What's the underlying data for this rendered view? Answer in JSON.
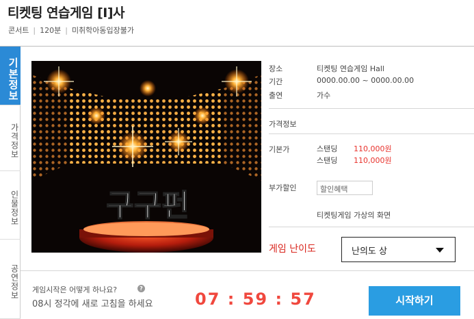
{
  "header": {
    "title": "티켓팅 연습게임 [I]사",
    "meta": [
      "콘서트",
      "120분",
      "미취학아동입장불가"
    ]
  },
  "tabs": [
    {
      "label": "기본정보",
      "active": true
    },
    {
      "label": "가격정보",
      "active": false
    },
    {
      "label": "인물정보",
      "active": false
    },
    {
      "label": "공연정보",
      "active": false
    }
  ],
  "poster": {
    "text": "구구펀"
  },
  "info": {
    "venue_label": "장소",
    "venue": "티켓팅 연습게임 Hall",
    "period_label": "기간",
    "period": "0000.00.00 ~ 0000.00.00",
    "cast_label": "출연",
    "cast": "가수",
    "price_section": "가격정보",
    "base_price_label": "기본가",
    "prices": [
      {
        "type": "스탠딩",
        "price": "110,000원"
      },
      {
        "type": "스탠딩",
        "price": "110,000원"
      }
    ],
    "discount_label": "부가할인",
    "discount_button": "할인혜택",
    "caption": "티켓팅게임 가상의 화면"
  },
  "difficulty": {
    "label": "게임 난이도",
    "selected": "난의도 상"
  },
  "footer": {
    "question": "게임시작은 어떻게 하나요?",
    "help_icon": "?",
    "notice": "08시 정각에 새로 고침을 하세요",
    "timer": "07 : 59 : 57",
    "start_button": "시작하기"
  },
  "colors": {
    "accent": "#2b8ad6",
    "price": "#e8322c",
    "timer": "#f0483e",
    "start": "#2a9de2"
  }
}
